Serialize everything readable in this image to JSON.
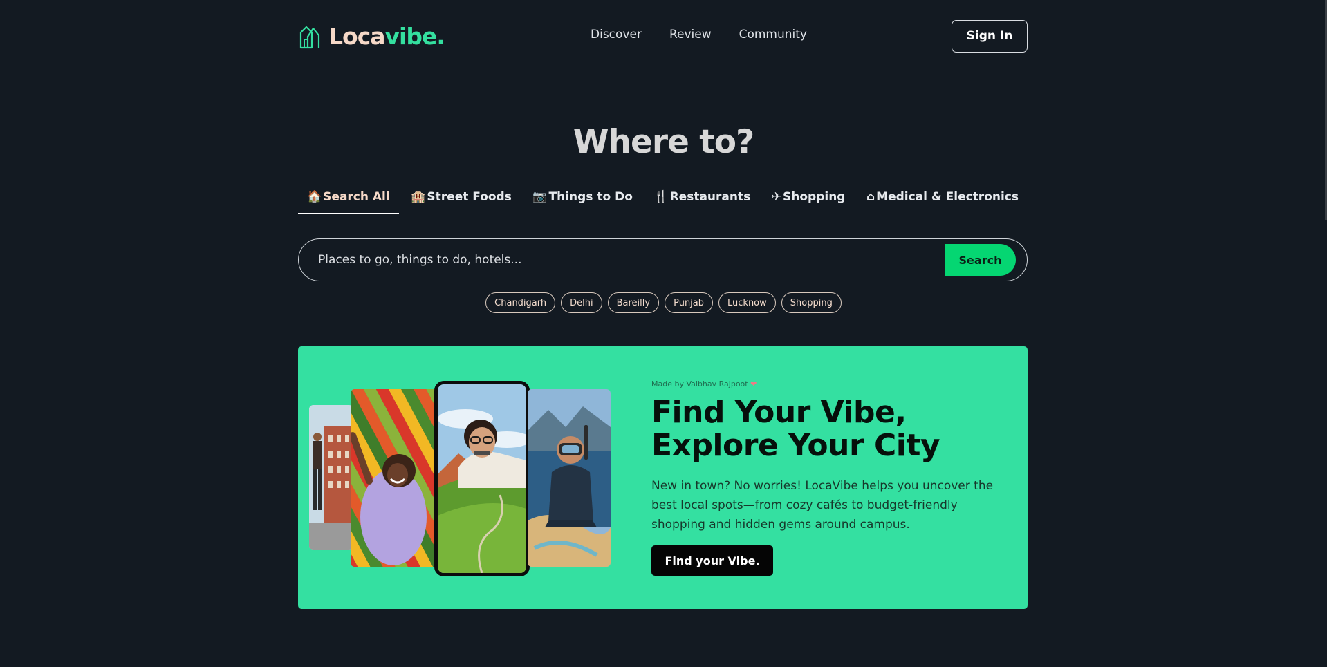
{
  "brand": {
    "name_part1": "Loca",
    "name_part2": "vibe."
  },
  "nav": {
    "items": [
      "Discover",
      "Review",
      "Community"
    ]
  },
  "header": {
    "signin_label": "Sign In"
  },
  "hero": {
    "title": "Where to?"
  },
  "tabs": [
    {
      "icon": "🏠",
      "icon_name": "home-emoji-icon",
      "label": "Search All"
    },
    {
      "icon": "🏨",
      "icon_name": "building-icon",
      "label": "Street Foods"
    },
    {
      "icon": "📷",
      "icon_name": "camera-icon",
      "label": "Things to Do"
    },
    {
      "icon": "🍴",
      "icon_name": "utensils-icon",
      "label": "Restaurants"
    },
    {
      "icon": "✈",
      "icon_name": "plane-icon",
      "label": "Shopping"
    },
    {
      "icon": "⌂",
      "icon_name": "house-icon",
      "label": "Medical & Electronics"
    }
  ],
  "search": {
    "placeholder": "Places to go, things to do, hotels...",
    "button_label": "Search"
  },
  "chips": [
    "Chandigarh",
    "Delhi",
    "Bareilly",
    "Punjab",
    "Lucknow",
    "Shopping"
  ],
  "banner": {
    "credit": "Made by Vaibhav Rajpoot",
    "credit_heart": "❤",
    "headline_line1": "Find Your Vibe,",
    "headline_line2": "Explore Your City",
    "description": "New in town? No worries! LocaVibe helps you uncover the best local spots—from cozy cafés to budget-friendly shopping and hidden gems around campus.",
    "cta_label": "Find your Vibe."
  },
  "colors": {
    "background": "#131a22",
    "accent": "#34e0a1",
    "search_button": "#05d672",
    "brand_cream": "#f6d9c8"
  }
}
